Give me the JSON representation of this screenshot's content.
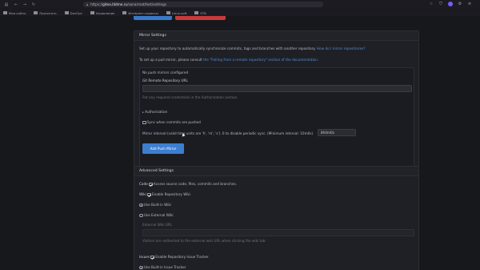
{
  "browser": {
    "url_prefix": "https://",
    "url_host": "gitea.tildme.ru",
    "url_path": "/sanarmat/test/settings",
    "bookmarks": [
      {
        "label": "Мои сайты"
      },
      {
        "label": "Прочитать"
      },
      {
        "label": "DevOps"
      },
      {
        "label": "Управление"
      },
      {
        "label": "Интернет-сервисы"
      },
      {
        "label": "Linux-soft"
      },
      {
        "label": "STB"
      }
    ]
  },
  "mirror": {
    "header": "Mirror Settings",
    "description": "Set up your repository to automatically synchronize commits, tags and branches with another repository.",
    "description_link": "How do I mirror repositories?",
    "pull_prefix": "To set up a pull mirror, please consult",
    "pull_link": "the \"Pulling from a remote repository\" section of the documentation.",
    "no_push": "No push mirrors configured",
    "remote_url_label": "Git Remote Repository URL",
    "remote_url_value": "",
    "credentials_hint": "Put any required credentials in the Authorization section.",
    "authorization_label": "Authorization",
    "sync_label": "Sync when commits are pushed",
    "interval_label": "Mirror interval (valid time units are 'h', 'm', 's'). 0 to disable periodic sync. (Minimum interval: 10m0s)",
    "interval_value": "8h0m0s",
    "add_button": "Add Push Mirror"
  },
  "advanced": {
    "header": "Advanced Settings",
    "code_label": "Code",
    "code_option": "Access source code, files, commits and branches.",
    "wiki_label": "Wiki",
    "wiki_option": "Enable Repository Wiki",
    "use_builtin_wiki": "Use Built-in Wiki",
    "use_external_wiki": "Use External Wiki",
    "external_wiki_url_label": "External Wiki URL",
    "external_wiki_url_placeholder": "",
    "external_wiki_hint": "Visitors are redirected to the external wiki URL when clicking the wiki tab.",
    "issues_label": "Issues",
    "issues_option": "Enable Repository Issue Tracker",
    "use_builtin_tracker": "Use Built-in Issue Tracker"
  },
  "colors": {
    "background": "#17181c",
    "panel": "#1f2025",
    "accent": "#3c7ed0",
    "danger": "#c93a3a",
    "link": "#4f8fd8"
  }
}
